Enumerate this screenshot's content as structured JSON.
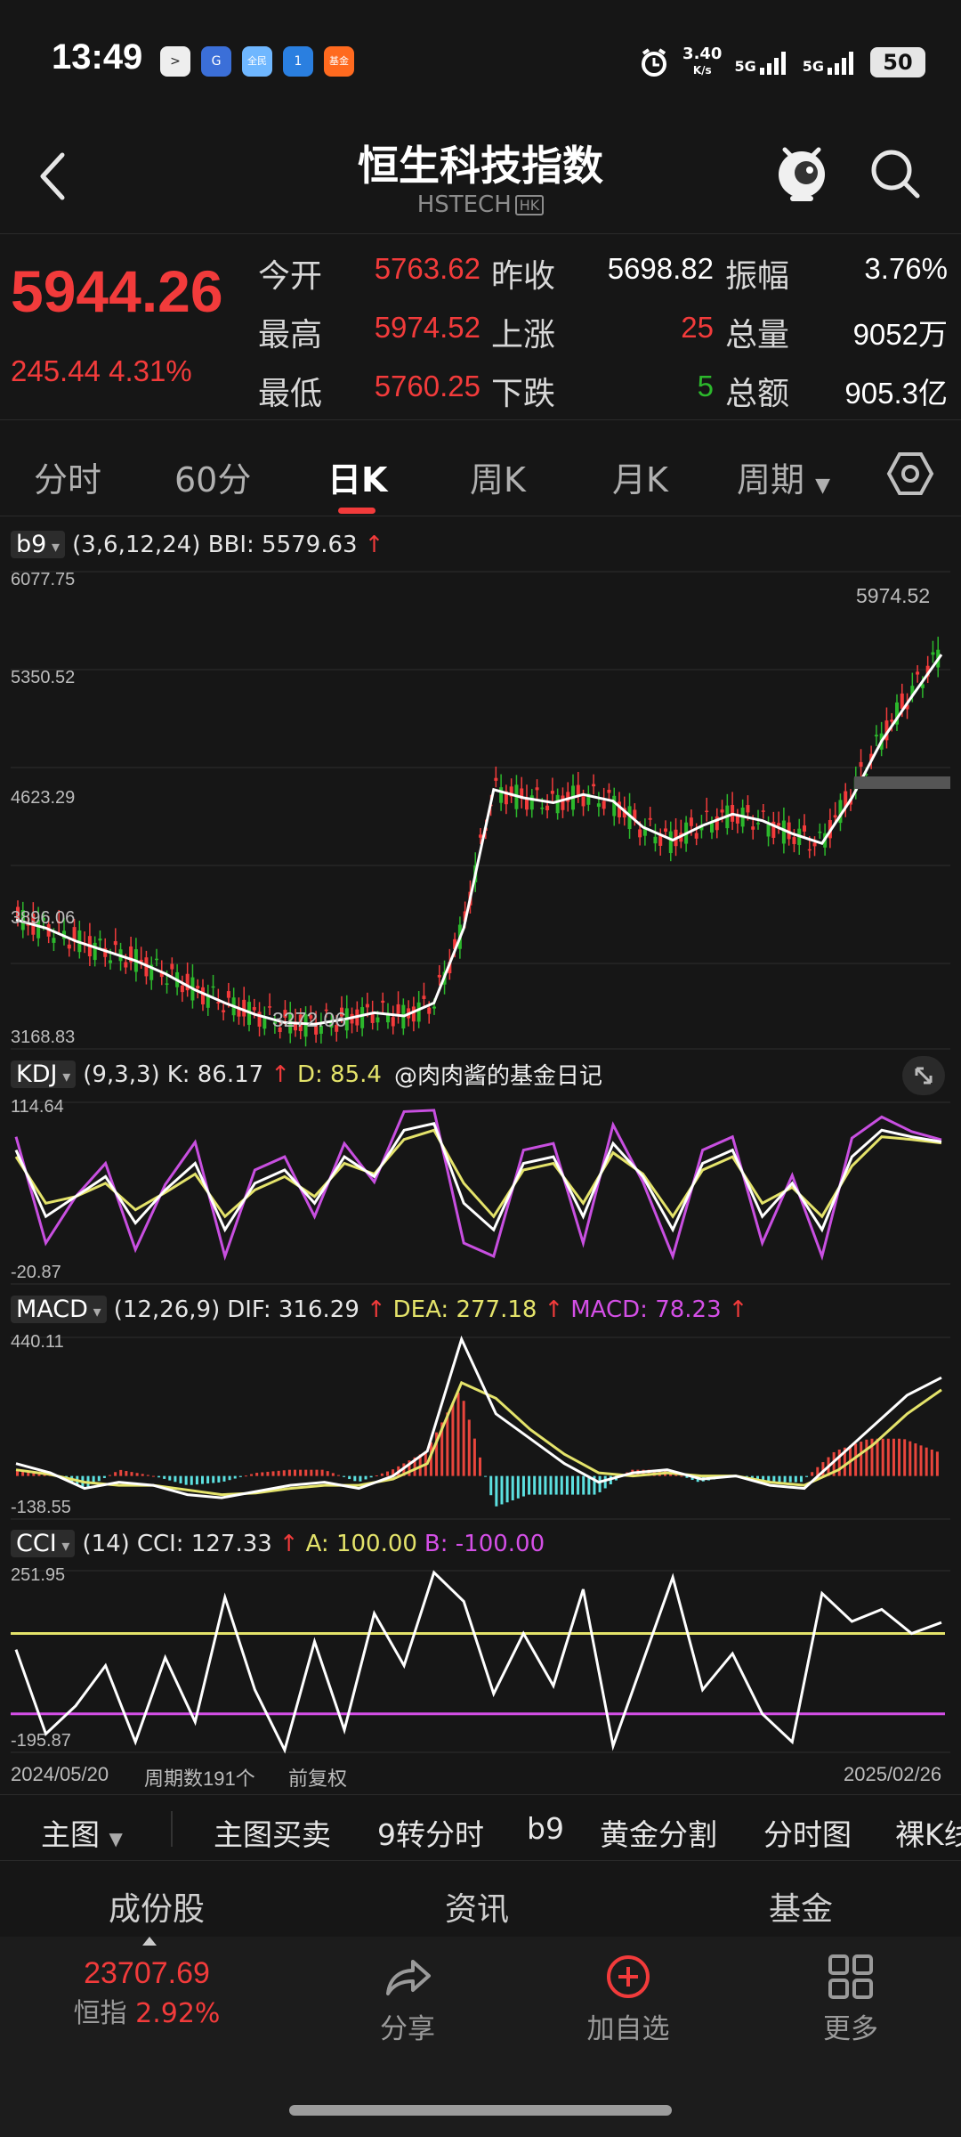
{
  "status_bar": {
    "time": "13:49",
    "net_speed": "3.40",
    "net_unit": "K/s",
    "signal1": "5G",
    "signal2": "5G",
    "battery": "50",
    "app_icons": [
      ">",
      "G",
      "全民",
      "1",
      "基金"
    ]
  },
  "header": {
    "title": "恒生科技指数",
    "code": "HSTECH",
    "market": "HK"
  },
  "quote": {
    "price": "5944.26",
    "change": "245.44",
    "change_pct": "4.31%",
    "open_label": "今开",
    "open": "5763.62",
    "prev_close_label": "昨收",
    "prev_close": "5698.82",
    "amplitude_label": "振幅",
    "amplitude": "3.76%",
    "high_label": "最高",
    "high": "5974.52",
    "up_label": "上涨",
    "up": "25",
    "volume_label": "总量",
    "volume": "9052万",
    "low_label": "最低",
    "low": "5760.25",
    "down_label": "下跌",
    "down": "5",
    "turnover_label": "总额",
    "turnover": "905.3亿"
  },
  "tabs": [
    "分时",
    "60分",
    "日K",
    "周K",
    "月K",
    "周期"
  ],
  "active_tab": "日K",
  "main_chart": {
    "indicator": "b9",
    "params": "(3,6,12,24) BBI: 5579.63",
    "y_max": "6077.75",
    "y_t2": "5350.52",
    "y_t3": "4623.29",
    "y_t4": "3896.06",
    "y_min": "3168.83",
    "high_label": "5974.52",
    "low_label": "3272.06"
  },
  "kdj": {
    "name": "KDJ",
    "params": "(9,3,3)",
    "k": "K: 86.17",
    "d": "D: 85.4",
    "y_max": "114.64",
    "y_min": "-20.87",
    "watermark": "@肉肉酱的基金日记"
  },
  "macd": {
    "name": "MACD",
    "params": "(12,26,9)",
    "dif": "DIF: 316.29",
    "dea": "DEA: 277.18",
    "macd": "MACD: 78.23",
    "y_max": "440.11",
    "y_min": "-138.55"
  },
  "cci": {
    "name": "CCI",
    "params": "(14)",
    "cci": "CCI: 127.33",
    "a": "A: 100.00",
    "b": "B: -100.00",
    "y_max": "251.95",
    "y_min": "-195.87"
  },
  "x_axis": {
    "start": "2024/05/20",
    "count": "周期数191个",
    "adjust": "前复权",
    "end": "2025/02/26"
  },
  "toolbar": [
    "主图",
    "主图买卖",
    "9转分时",
    "b9",
    "黄金分割",
    "分时图",
    "裸K线"
  ],
  "section_tabs": [
    "成份股",
    "资讯",
    "基金"
  ],
  "bottom_nav": {
    "index_value": "23707.69",
    "index_name": "恒指",
    "index_change": "2.92%",
    "share": "分享",
    "add": "加自选",
    "more": "更多"
  },
  "chart_data": [
    {
      "type": "candlestick",
      "title": "b9 (3,6,12,24) BBI: 5579.63",
      "x_start": "2024/05/20",
      "x_end": "2025/02/26",
      "ylim": [
        3168.83,
        6077.75
      ],
      "y_ticks": [
        6077.75,
        5350.52,
        4623.29,
        3896.06,
        3168.83
      ],
      "annotations": [
        "5974.52",
        "3272.06"
      ],
      "series": [
        {
          "name": "BBI",
          "values": [
            3950,
            3900,
            3820,
            3760,
            3700,
            3620,
            3520,
            3440,
            3370,
            3320,
            3310,
            3340,
            3380,
            3360,
            3440,
            3900,
            4750,
            4700,
            4670,
            4720,
            4680,
            4520,
            4440,
            4530,
            4600,
            4560,
            4480,
            4420,
            4700,
            5050,
            5320,
            5579.63
          ]
        }
      ]
    },
    {
      "type": "line",
      "title": "KDJ (9,3,3)",
      "ylim": [
        -20.87,
        114.64
      ],
      "series": [
        {
          "name": "K",
          "values": [
            80,
            30,
            45,
            60,
            25,
            50,
            70,
            20,
            55,
            65,
            40,
            75,
            60,
            95,
            100,
            40,
            20,
            70,
            75,
            30,
            85,
            60,
            20,
            70,
            80,
            30,
            55,
            20,
            75,
            95,
            90,
            86.17
          ]
        },
        {
          "name": "D",
          "values": [
            75,
            40,
            45,
            55,
            35,
            48,
            62,
            30,
            50,
            60,
            45,
            70,
            62,
            88,
            95,
            55,
            30,
            65,
            70,
            40,
            78,
            62,
            30,
            65,
            75,
            40,
            52,
            30,
            68,
            90,
            88,
            85.4
          ]
        }
      ]
    },
    {
      "type": "bar",
      "title": "MACD (12,26,9)",
      "ylim": [
        -138.55,
        440.11
      ],
      "series": [
        {
          "name": "DIF",
          "values": [
            40,
            10,
            -40,
            -20,
            -30,
            -60,
            -70,
            -50,
            -30,
            -20,
            -40,
            0,
            80,
            440.11,
            200,
            120,
            40,
            -20,
            10,
            20,
            -10,
            0,
            -30,
            -40,
            60,
            160,
            260,
            316.29
          ]
        },
        {
          "name": "DEA",
          "values": [
            20,
            5,
            -20,
            -30,
            -30,
            -45,
            -60,
            -55,
            -40,
            -30,
            -30,
            -10,
            40,
            300,
            250,
            150,
            70,
            10,
            0,
            10,
            0,
            0,
            -20,
            -30,
            20,
            100,
            200,
            277.18
          ]
        },
        {
          "name": "MACD",
          "values": [
            20,
            10,
            -40,
            20,
            0,
            -30,
            -20,
            10,
            20,
            20,
            -20,
            20,
            80,
            280,
            -100,
            -60,
            -60,
            -60,
            20,
            20,
            -20,
            0,
            -20,
            -20,
            80,
            120,
            120,
            78.23
          ]
        }
      ]
    },
    {
      "type": "line",
      "title": "CCI (14)",
      "ylim": [
        -195.87,
        251.95
      ],
      "series": [
        {
          "name": "CCI",
          "values": [
            60,
            -150,
            -80,
            20,
            -170,
            40,
            -120,
            190,
            -40,
            -190,
            80,
            -140,
            150,
            20,
            251.95,
            180,
            -50,
            100,
            -30,
            210,
            -180,
            30,
            240,
            -40,
            50,
            -100,
            -170,
            200,
            130,
            160,
            100,
            127.33
          ]
        },
        {
          "name": "A",
          "values": [
            100
          ]
        },
        {
          "name": "B",
          "values": [
            -100
          ]
        }
      ]
    }
  ]
}
